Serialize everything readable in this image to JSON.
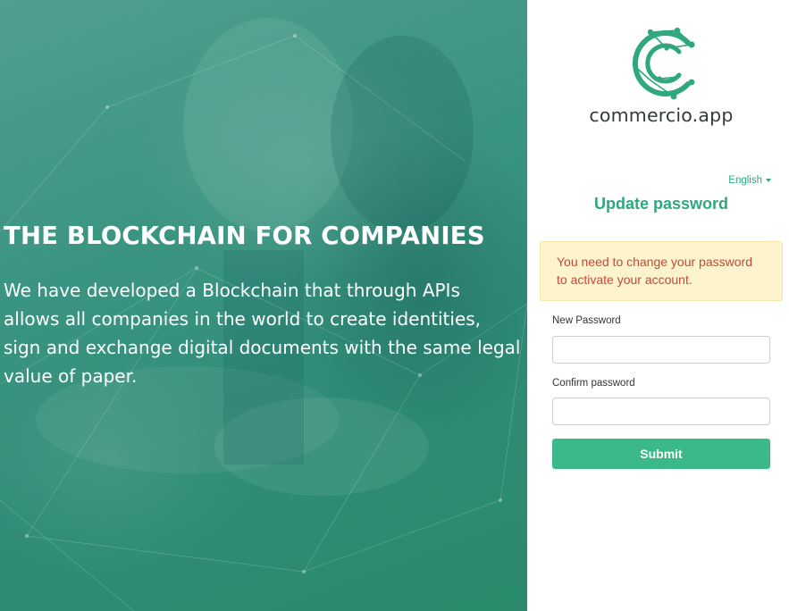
{
  "hero": {
    "title": "THE BLOCKCHAIN FOR COMPANIES",
    "lines": [
      "We have developed a Blockchain that through APIs",
      "allows all companies in the world to create identities,",
      "sign and exchange digital documents with the same legal",
      "value of paper."
    ]
  },
  "brand": {
    "name": "commercio.app",
    "logo_icon": "commercio-c-network-logo",
    "accent_color": "#2fa77f",
    "button_color": "#3bb98a"
  },
  "language": {
    "selected": "English"
  },
  "form": {
    "title": "Update password",
    "alert": "You need to change your password to activate your account.",
    "new_password_label": "New Password",
    "new_password_value": "",
    "confirm_password_label": "Confirm password",
    "confirm_password_value": "",
    "submit_label": "Submit"
  }
}
